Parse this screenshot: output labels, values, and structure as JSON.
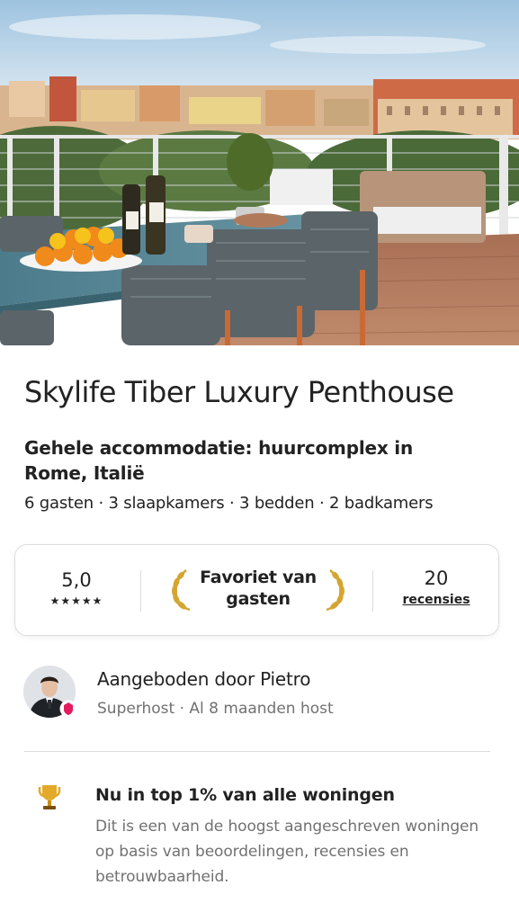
{
  "listing": {
    "title": "Skylife Tiber Luxury Penthouse",
    "subtitle": "Gehele accommodatie: huurcomplex in Rome, Italië",
    "details": "6 gasten · 3 slaapkamers · 3 bedden · 2 badkamers"
  },
  "rating_card": {
    "score": "5,0",
    "stars": "★★★★★",
    "star_count": 5,
    "favorite_label": "Favoriet van gasten",
    "review_count": "20",
    "review_label": "recensies"
  },
  "host": {
    "title": "Aangeboden door Pietro",
    "meta": "Superhost · Al 8 maanden host",
    "avatar_icon": "host-avatar",
    "badge_icon": "superhost-badge-icon",
    "badge_color": "#e31c5f"
  },
  "highlight": {
    "icon": "trophy-icon",
    "title": "Nu in top 1% van alle woningen",
    "body": "Dit is een van de hoogst aangeschreven woningen op basis van beoordelingen, recensies en betrouwbaarheid."
  },
  "colors": {
    "text_primary": "#222222",
    "text_secondary": "#717171",
    "border": "#dddddd",
    "laurel_gold": "#d4a531",
    "trophy_gold": "#e2a92a"
  }
}
